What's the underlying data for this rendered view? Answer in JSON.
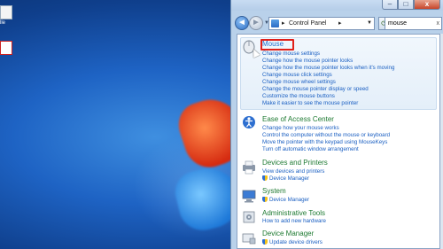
{
  "desktop": {
    "icons": [
      {
        "label": "lle",
        "type": "file"
      },
      {
        "label": "",
        "type": "pdf"
      }
    ]
  },
  "window": {
    "titlebar": {
      "minimize": "–",
      "maximize": "□",
      "close": "x"
    },
    "nav": {
      "back": "◄",
      "forward": "►",
      "dropdown": "▼"
    },
    "address": {
      "separator": "▸",
      "location": "Control Panel",
      "dropdown": "▼"
    },
    "refresh_glyph": "⟳",
    "search": {
      "value": "mouse",
      "clear": "x"
    }
  },
  "results": [
    {
      "title": "Mouse",
      "icon": "mouse-icon",
      "links": [
        "Change mouse settings",
        "Change how the mouse pointer looks",
        "Change how the mouse pointer looks when it's moving",
        "Change mouse click settings",
        "Change mouse wheel settings",
        "Change the mouse pointer display or speed",
        "Customize the mouse buttons",
        "Make it easier to see the mouse pointer"
      ]
    },
    {
      "title": "Ease of Access Center",
      "icon": "ease-of-access-icon",
      "links": [
        "Change how your mouse works",
        "Control the computer without the mouse or keyboard",
        "Move the pointer with the keypad using MouseKeys",
        "Turn off automatic window arrangement"
      ]
    },
    {
      "title": "Devices and Printers",
      "icon": "devices-printers-icon",
      "links": [
        "View devices and printers",
        "Device Manager"
      ]
    },
    {
      "title": "System",
      "icon": "system-icon",
      "links": [
        "Device Manager"
      ]
    },
    {
      "title": "Administrative Tools",
      "icon": "admin-tools-icon",
      "links": [
        "How to add new hardware"
      ]
    },
    {
      "title": "Device Manager",
      "icon": "device-manager-icon",
      "links": [
        "Update device drivers"
      ]
    }
  ],
  "colors": {
    "highlight_box": "#e0201a",
    "link": "#1a5fc2",
    "category_title": "#1e7a32"
  }
}
